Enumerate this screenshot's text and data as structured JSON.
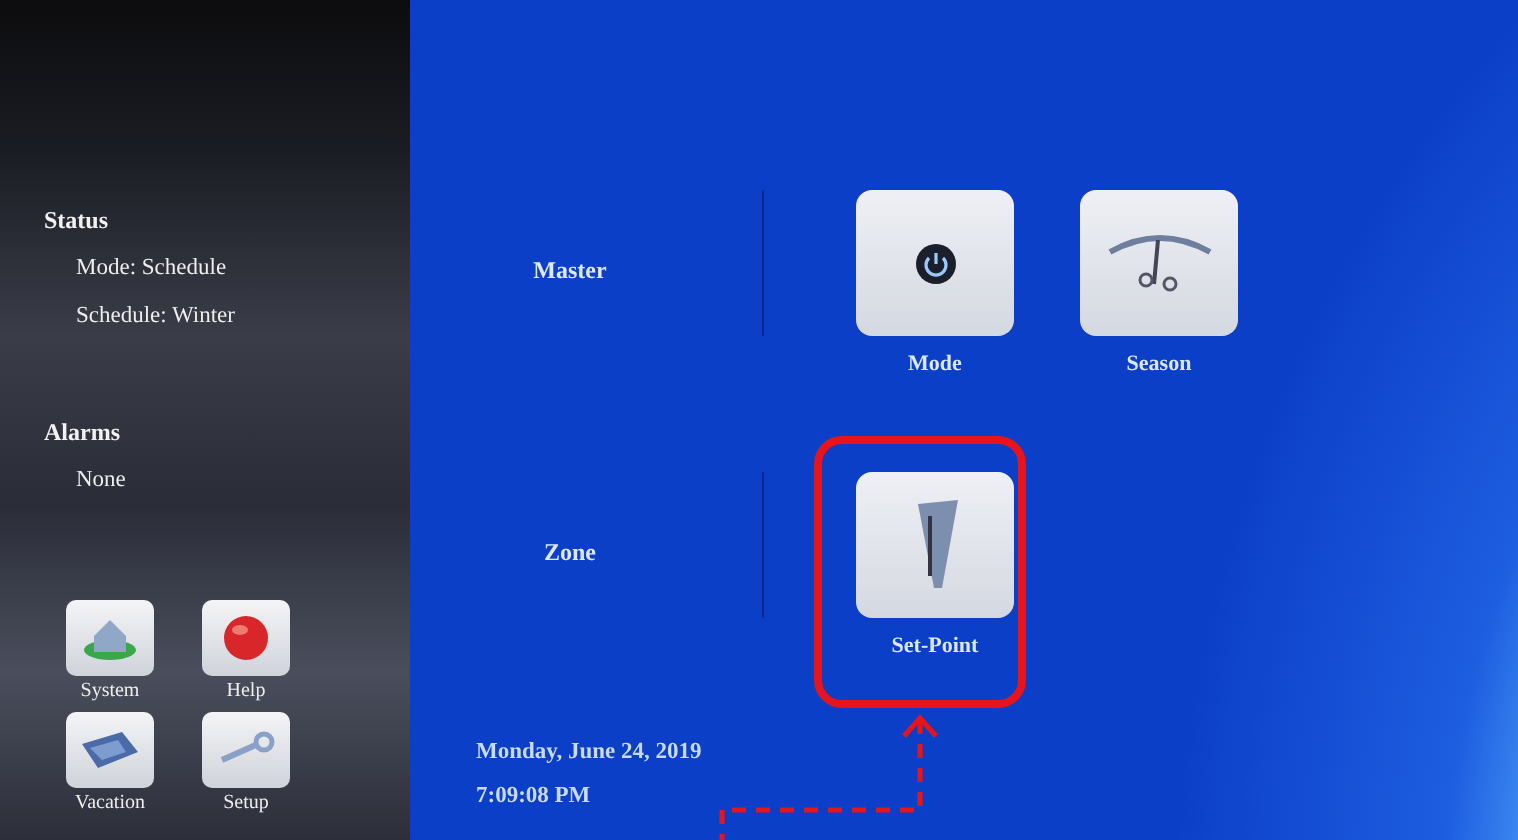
{
  "sidebar": {
    "sections": [
      {
        "title": "Status",
        "lines": [
          "Mode: Schedule",
          "Schedule: Winter"
        ]
      },
      {
        "title": "Alarms",
        "lines": [
          "None"
        ]
      }
    ],
    "buttons": [
      {
        "label": "System",
        "kind": "house"
      },
      {
        "label": "Help",
        "kind": "button"
      },
      {
        "label": "Vacation",
        "kind": "folder"
      },
      {
        "label": "Setup",
        "kind": "wrench"
      }
    ]
  },
  "groups": [
    {
      "label": "Master",
      "tiles": [
        {
          "label": "Mode",
          "kind": "power",
          "highlighted": false
        },
        {
          "label": "Season",
          "kind": "gauge",
          "highlighted": false
        }
      ]
    },
    {
      "label": "Zone",
      "tiles": [
        {
          "label": "Set-Point",
          "kind": "ruler",
          "highlighted": true
        }
      ]
    }
  ],
  "clock": {
    "date": "Monday, June 24, 2019",
    "time": "7:09:08 PM"
  }
}
